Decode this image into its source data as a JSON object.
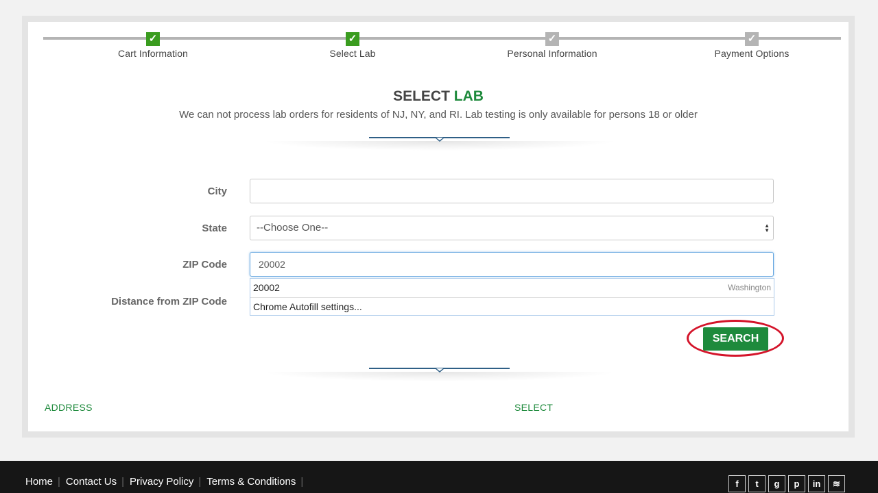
{
  "steps": [
    {
      "label": "Cart Information",
      "status": "complete",
      "icon": "check-icon"
    },
    {
      "label": "Select Lab",
      "status": "complete",
      "icon": "check-icon"
    },
    {
      "label": "Personal Information",
      "status": "pending",
      "icon": "check-icon"
    },
    {
      "label": "Payment Options",
      "status": "pending",
      "icon": "check-icon"
    }
  ],
  "heading": {
    "title_part1": "SELECT",
    "title_part2": "LAB",
    "subtitle": "We can not process lab orders for residents of NJ, NY, and RI. Lab testing is only available for persons 18 or older"
  },
  "form": {
    "city_label": "City",
    "city_value": "",
    "state_label": "State",
    "state_value": "--Choose One--",
    "zip_label": "ZIP Code",
    "zip_value": "20002",
    "distance_label": "Distance from ZIP Code",
    "search_label": "SEARCH"
  },
  "autofill": {
    "suggestion": "20002",
    "suggestion_hint": "Washington",
    "settings": "Chrome Autofill settings..."
  },
  "results": {
    "col_address": "ADDRESS",
    "col_select": "SELECT"
  },
  "footer": {
    "links": [
      "Home",
      "Contact Us",
      "Privacy Policy",
      "Terms & Conditions"
    ],
    "social": [
      "facebook-icon",
      "twitter-icon",
      "google-plus-icon",
      "pinterest-icon",
      "linkedin-icon",
      "rss-icon"
    ]
  },
  "colors": {
    "accent_green": "#1e8a3c",
    "step_done": "#3a9c1f",
    "step_pending": "#b4b4b4",
    "highlight_circle": "#d4142a",
    "footer_bg": "#161616"
  }
}
